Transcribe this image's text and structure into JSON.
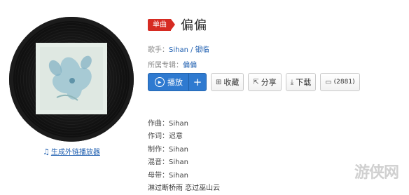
{
  "badge": "单曲",
  "song": {
    "title": "偏偏"
  },
  "singer": {
    "label": "歌手：",
    "names": [
      "Sihan",
      "银临"
    ],
    "sep": " / "
  },
  "album": {
    "label": "所属专辑：",
    "name": "偏偏"
  },
  "actions": {
    "play": "播放",
    "add": "+",
    "collect": "收藏",
    "share": "分享",
    "download": "下载",
    "comment_count": "(2881)"
  },
  "player_link": "生成外链播放器",
  "credits": [
    "作曲：Sihan",
    "作词：迟意",
    "制作：Sihan",
    "混音：Sihan",
    "母带：Sihan"
  ],
  "lyric_line": "淋过断桥雨 恋过巫山云",
  "watermark": "游侠网",
  "colors": {
    "accent": "#2f7ad0",
    "badge": "#d62b22",
    "link": "#1f5fb0"
  }
}
